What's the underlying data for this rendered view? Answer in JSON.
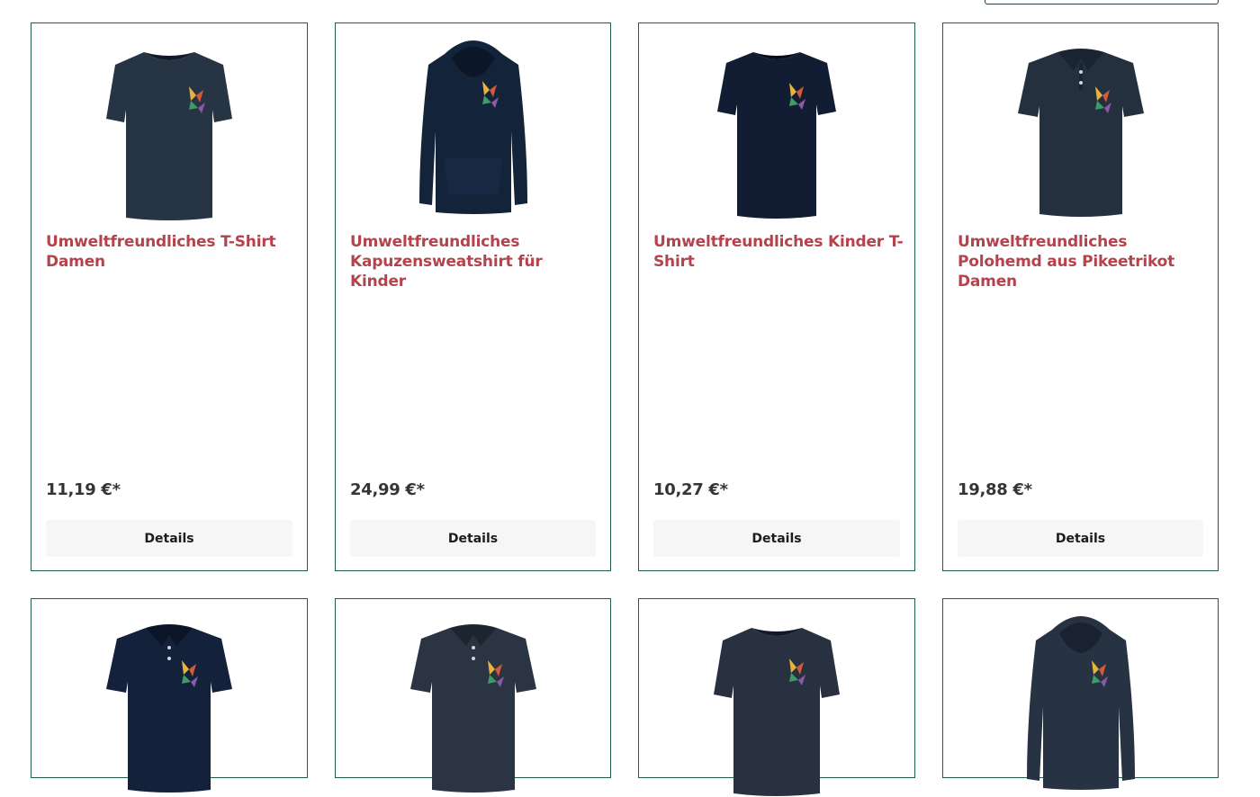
{
  "sort": {
    "selected": ""
  },
  "products": [
    {
      "title": "Umweltfreundliches T-Shirt Damen",
      "price": "11,19 €*",
      "button": "Details",
      "garment": "tshirt-icon",
      "color": "#273444"
    },
    {
      "title": "Umweltfreundliches Kapuzensweatshirt für Kinder",
      "price": "24,99 €*",
      "button": "Details",
      "garment": "hoodie-icon",
      "color": "#13233a"
    },
    {
      "title": "Umweltfreundliches Kinder T-Shirt",
      "price": "10,27 €*",
      "button": "Details",
      "garment": "tshirt-icon",
      "color": "#121d33"
    },
    {
      "title": "Umweltfreundliches Polohemd aus Pikeetrikot Damen",
      "price": "19,88 €*",
      "button": "Details",
      "garment": "polo-icon",
      "color": "#25303f"
    }
  ],
  "products_row2": [
    {
      "garment": "polo-icon",
      "color": "#13213a"
    },
    {
      "garment": "polo-icon",
      "color": "#2a3442"
    },
    {
      "garment": "tshirt-icon",
      "color": "#27313f"
    },
    {
      "garment": "hoodie-icon",
      "color": "#273242"
    }
  ],
  "logo_colors": [
    "#e8b23c",
    "#d45a3a",
    "#3f9a6a",
    "#8a5aa8"
  ]
}
